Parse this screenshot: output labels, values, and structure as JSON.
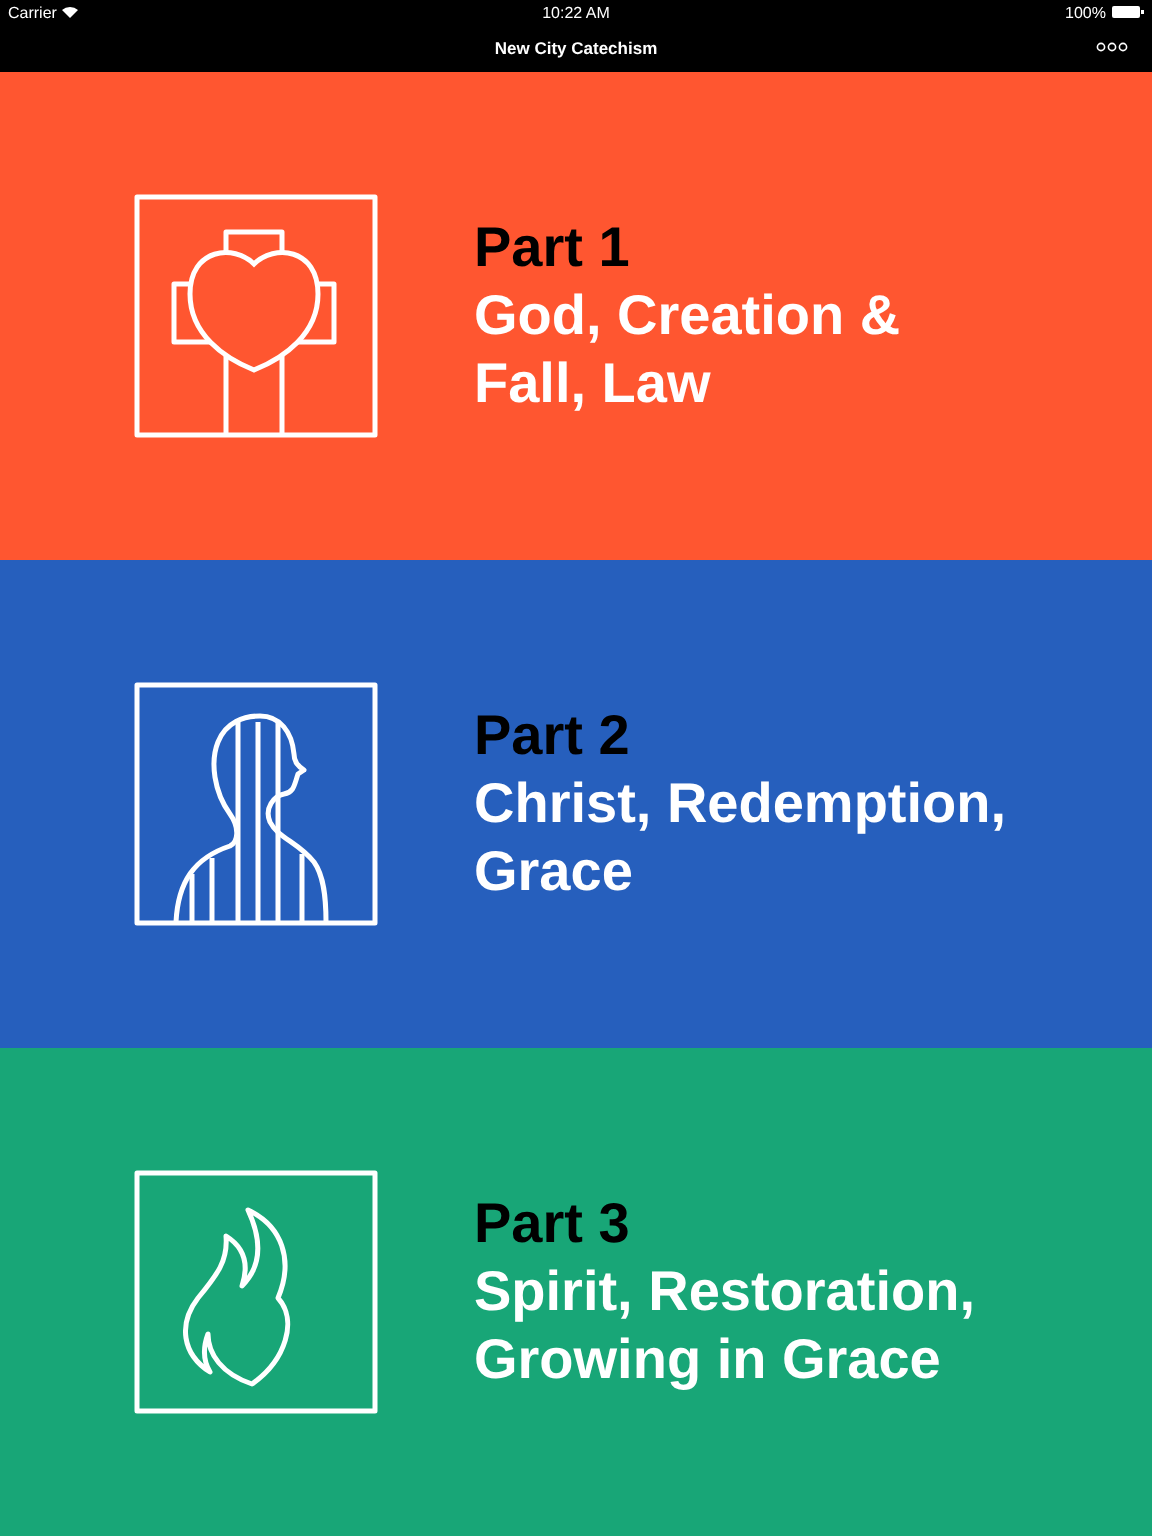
{
  "status_bar": {
    "carrier": "Carrier",
    "time": "10:22 AM",
    "battery": "100%"
  },
  "nav_bar": {
    "title": "New City Catechism"
  },
  "parts": [
    {
      "kind": "cross-heart",
      "color": "#ff5630",
      "label": "Part 1",
      "title_lines": [
        "God, Creation &",
        "Fall, Law"
      ]
    },
    {
      "kind": "figure",
      "color": "#265fbd",
      "label": "Part 2",
      "title_lines": [
        "Christ, Redemption,",
        "Grace"
      ]
    },
    {
      "kind": "flame",
      "color": "#18a677",
      "label": "Part 3",
      "title_lines": [
        "Spirit, Restoration,",
        "Growing in Grace"
      ]
    }
  ]
}
